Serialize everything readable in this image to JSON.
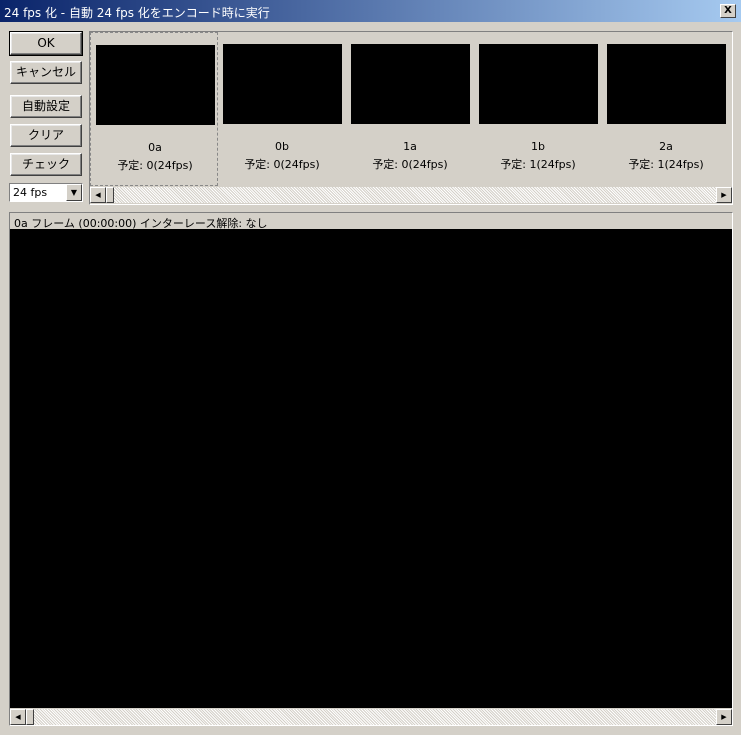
{
  "window": {
    "title": "24 fps 化 - 自動 24 fps 化をエンコード時に実行",
    "close_label": "X"
  },
  "buttons": {
    "ok": "OK",
    "cancel": "キャンセル",
    "auto": "自動設定",
    "clear": "クリア",
    "check": "チェック"
  },
  "fps_select": {
    "value": "24 fps",
    "arrow": "▼"
  },
  "thumbnails": [
    {
      "name": "0a",
      "schedule": "予定: 0(24fps)"
    },
    {
      "name": "0b",
      "schedule": "予定: 0(24fps)"
    },
    {
      "name": "1a",
      "schedule": "予定: 0(24fps)"
    },
    {
      "name": "1b",
      "schedule": "予定: 1(24fps)"
    },
    {
      "name": "2a",
      "schedule": "予定: 1(24fps)"
    }
  ],
  "preview": {
    "info": "0a フレーム (00:00:00) インターレース解除: なし"
  },
  "scroll": {
    "left": "◀",
    "right": "▶"
  }
}
